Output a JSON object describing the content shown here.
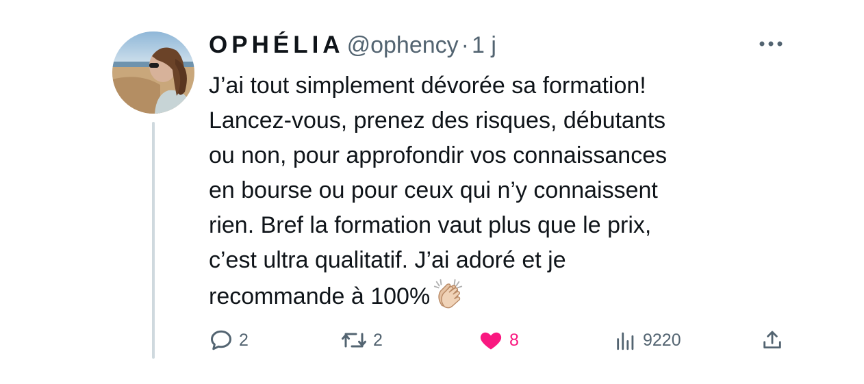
{
  "tweet": {
    "display_name": "OPHÉLIA",
    "handle": "@ophency",
    "separator": "·",
    "time": "1 j",
    "text_lines": [
      "J’ai tout simplement dévorée sa formation!",
      "Lancez-vous, prenez des risques, débutants",
      "ou non, pour approfondir vos connaissances",
      "en bourse ou pour ceux qui n’y connaissent",
      "rien. Bref la formation vaut plus que le prix,",
      "c’est ultra qualitatif. J’ai adoré et je",
      "recommande à 100%"
    ],
    "emoji": "clapping-hands-emoji"
  },
  "actions": {
    "reply_count": "2",
    "retweet_count": "2",
    "like_count": "8",
    "views_count": "9220"
  },
  "icons": {
    "more": "more-horizontal-icon",
    "reply": "reply-icon",
    "retweet": "retweet-icon",
    "like": "heart-icon",
    "views": "views-icon",
    "share": "share-icon"
  },
  "colors": {
    "text": "#0f1419",
    "secondary": "#536471",
    "like": "#f91880",
    "thread_line": "#cfd9de"
  }
}
